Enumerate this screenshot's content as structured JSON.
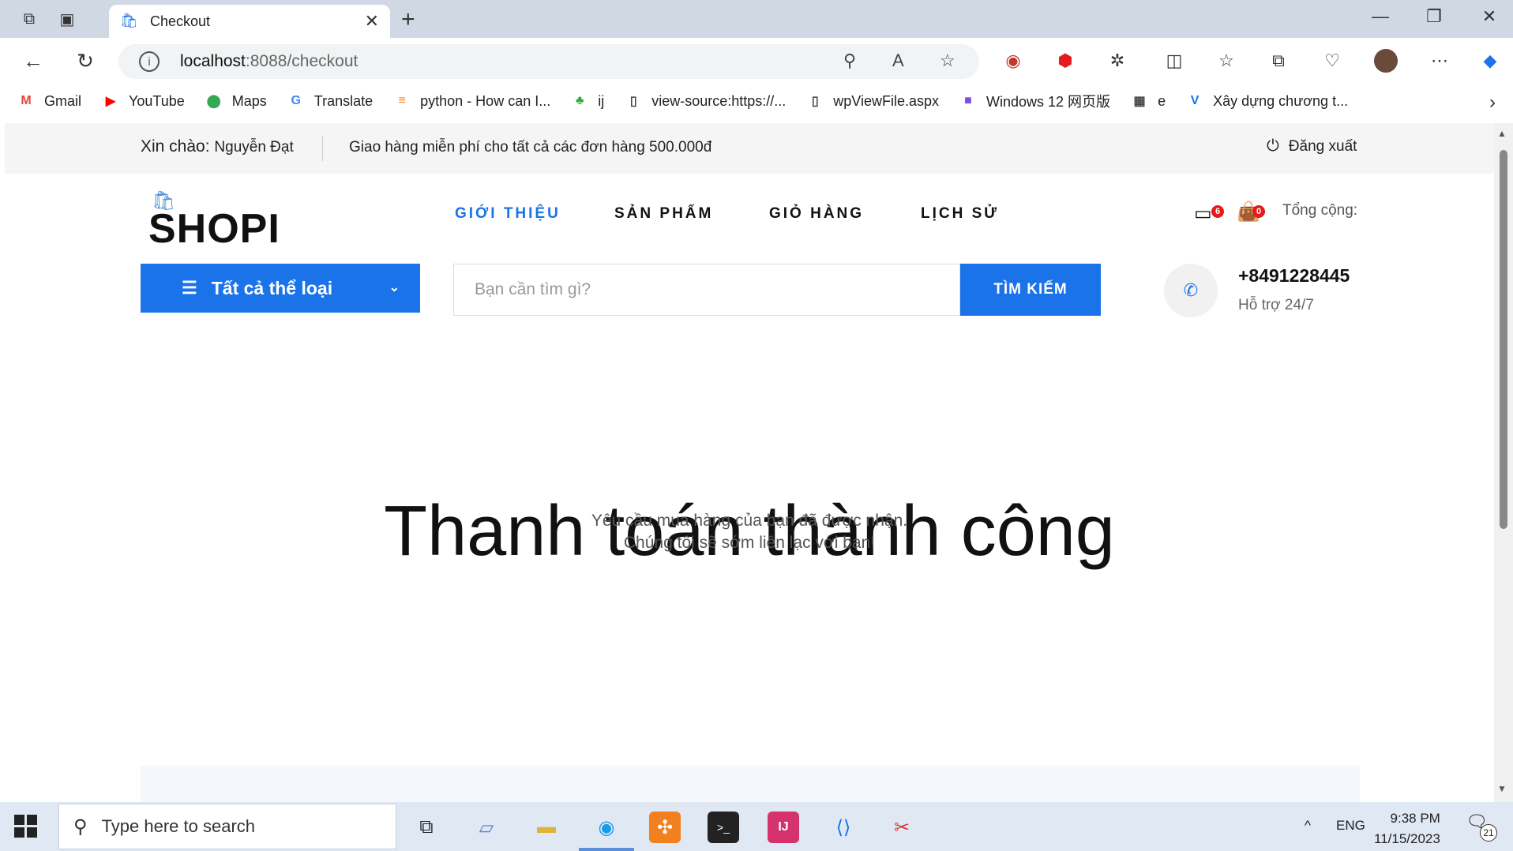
{
  "browser": {
    "tab_title": "Checkout",
    "url_host": "localhost",
    "url_path": ":8088/checkout",
    "bookmarks": [
      {
        "label": "Gmail",
        "icon": "gmail-icon",
        "glyph": "M",
        "color": "#ea4335"
      },
      {
        "label": "YouTube",
        "icon": "youtube-icon",
        "glyph": "▶",
        "color": "#ff0000"
      },
      {
        "label": "Maps",
        "icon": "maps-icon",
        "glyph": "⬤",
        "color": "#34a853"
      },
      {
        "label": "Translate",
        "icon": "translate-icon",
        "glyph": "G",
        "color": "#4285f4"
      },
      {
        "label": "python - How can I...",
        "icon": "stackoverflow-icon",
        "glyph": "≡",
        "color": "#f48024"
      },
      {
        "label": "ij",
        "icon": "leaf-icon",
        "glyph": "♣",
        "color": "#2eaa3a"
      },
      {
        "label": "view-source:https://...",
        "icon": "page-icon",
        "glyph": "▯",
        "color": "#444"
      },
      {
        "label": "wpViewFile.aspx",
        "icon": "page-icon",
        "glyph": "▯",
        "color": "#444"
      },
      {
        "label": "Windows 12 网页版",
        "icon": "windows-icon",
        "glyph": "■",
        "color": "#7b4fe0"
      },
      {
        "label": "e",
        "icon": "calendar-icon",
        "glyph": "▦",
        "color": "#444"
      },
      {
        "label": "Xây dựng chương t...",
        "icon": "v-icon",
        "glyph": "V",
        "color": "#1a73e8"
      }
    ]
  },
  "topbar": {
    "greeting_prefix": "Xin chào:",
    "user_name": "Nguyễn Đạt",
    "shipping_msg": "Giao hàng miễn phí cho tất cả các đơn hàng 500.000đ",
    "logout": "Đăng xuất"
  },
  "header": {
    "logo": "SHOPI",
    "nav": [
      {
        "label": "GIỚI THIỆU",
        "active": true
      },
      {
        "label": "SẢN PHẨM",
        "active": false
      },
      {
        "label": "GIỎ HÀNG",
        "active": false
      },
      {
        "label": "LỊCH SỬ",
        "active": false
      }
    ],
    "card_badge": "6",
    "cart_badge": "0",
    "total_label": "Tổng cộng:",
    "category_button": "Tất cả thể loại",
    "search_placeholder": "Bạn cần tìm gì?",
    "search_button": "TÌM KIẾM",
    "phone": "+8491228445",
    "support": "Hỗ trợ 24/7"
  },
  "content": {
    "title": "Thanh toán thành công",
    "line1": "Yêu cầu mua hàng của bạn đã được nhận.",
    "line2": "Chúng tôi sẽ sớm liên lạc với bạn!"
  },
  "taskbar": {
    "search_placeholder": "Type here to search",
    "lang": "ENG",
    "time": "9:38 PM",
    "date": "11/15/2023",
    "notifications": "21"
  },
  "colors": {
    "accent": "#1a73e8",
    "badge": "#e41b1b"
  }
}
